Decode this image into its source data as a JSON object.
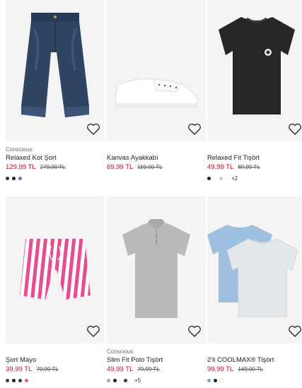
{
  "products": [
    {
      "tag": "Conscious",
      "name": "Relaxed Kot Şort",
      "price": "129,99 TL",
      "old_price": "279,00 TL",
      "swatches": [
        "#2f3640",
        "#222222",
        "#6c7fa0"
      ],
      "more": ""
    },
    {
      "tag": "",
      "name": "Kanvas Ayakkabı",
      "price": "69,99 TL",
      "old_price": "119,00 TL",
      "swatches": [],
      "more": ""
    },
    {
      "tag": "",
      "name": "Relaxed Fit Tişört",
      "price": "49,99 TL",
      "old_price": "89,99 TL",
      "swatches": [
        "#1e1e1e",
        "#c9cbd6"
      ],
      "more": "+2"
    },
    {
      "tag": "",
      "name": "Şort Mayo",
      "price": "39,99 TL",
      "old_price": "79,99 TL",
      "swatches": [
        "#3a3f52",
        "#1e1e1e",
        "#3b3b3b",
        "#d86a7a"
      ],
      "more": ""
    },
    {
      "tag": "Conscious",
      "name": "Slim Fit Polo Tişört",
      "price": "49,99 TL",
      "old_price": "79,99 TL",
      "swatches": [
        "#a8a8a8",
        "#1e1e1e",
        "#3b3b3b"
      ],
      "more": "+5"
    },
    {
      "tag": "",
      "name": "2'li COOLMAX® Tişört",
      "price": "99,99 TL",
      "old_price": "149,00 TL",
      "swatches": [
        "#7ea3c8",
        "#222222",
        "#ffffff"
      ],
      "more": ""
    }
  ],
  "icons": {
    "favorite": "heart-outline-icon"
  },
  "colors": {
    "sale_price": "#c8102e",
    "card_bg": "#f4f4f4"
  }
}
